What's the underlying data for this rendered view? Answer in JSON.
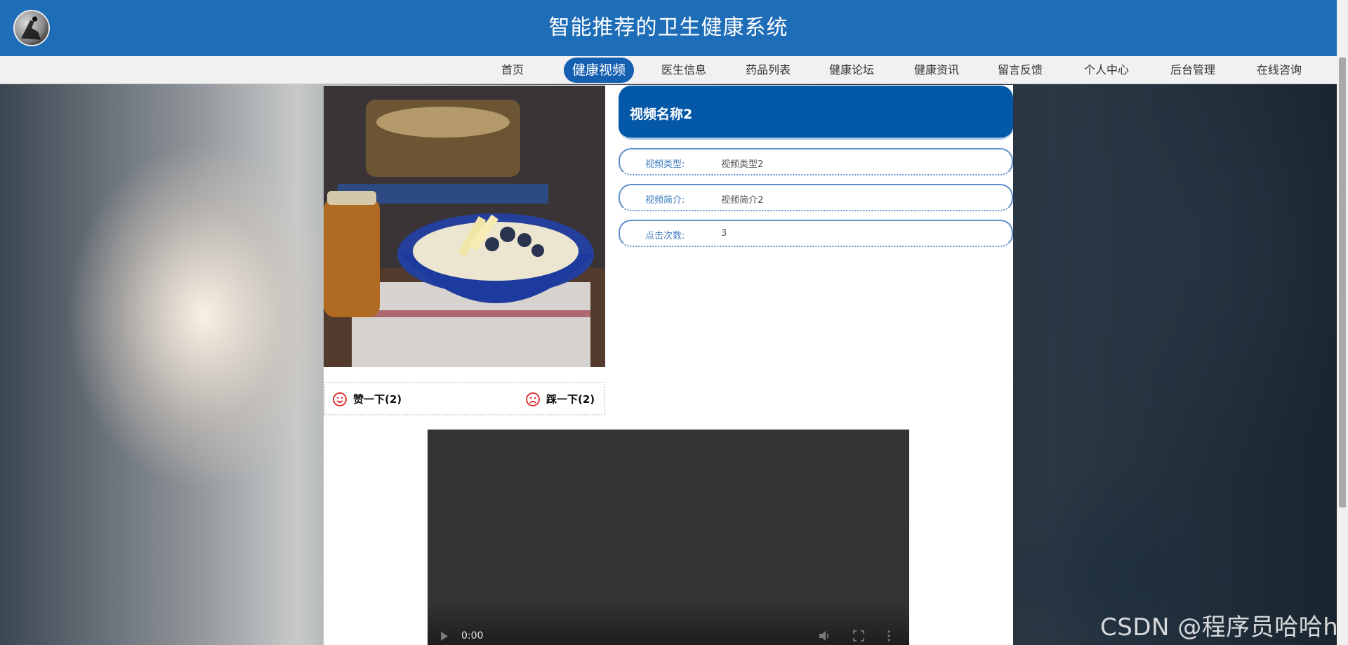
{
  "header": {
    "title": "智能推荐的卫生健康系统"
  },
  "nav": {
    "items": [
      {
        "label": "首页"
      },
      {
        "label": "健康视频",
        "active": true
      },
      {
        "label": "医生信息"
      },
      {
        "label": "药品列表"
      },
      {
        "label": "健康论坛"
      },
      {
        "label": "健康资讯"
      },
      {
        "label": "留言反馈"
      },
      {
        "label": "个人中心"
      },
      {
        "label": "后台管理"
      },
      {
        "label": "在线咨询"
      }
    ]
  },
  "detail": {
    "name": "视频名称2",
    "fields": [
      {
        "key": "视频类型:",
        "value": "视频类型2"
      },
      {
        "key": "视频简介:",
        "value": "视频简介2"
      },
      {
        "key": "点击次数:",
        "value": "3"
      }
    ]
  },
  "votes": {
    "like_label": "赞一下(2)",
    "like_icon": "smile-icon",
    "dislike_label": "踩一下(2)",
    "dislike_icon": "frown-icon"
  },
  "player": {
    "time": "0:00",
    "icons": [
      "play-icon",
      "volume-icon",
      "fullscreen-icon",
      "more-icon"
    ]
  },
  "watermark": "CSDN @程序员哈哈h",
  "colors": {
    "header_bg": "#1e6db8",
    "active_nav": "#1660b2",
    "title_box": "#0458a8",
    "field_key": "#3f7dc0",
    "vote_icon": "#e02424"
  }
}
